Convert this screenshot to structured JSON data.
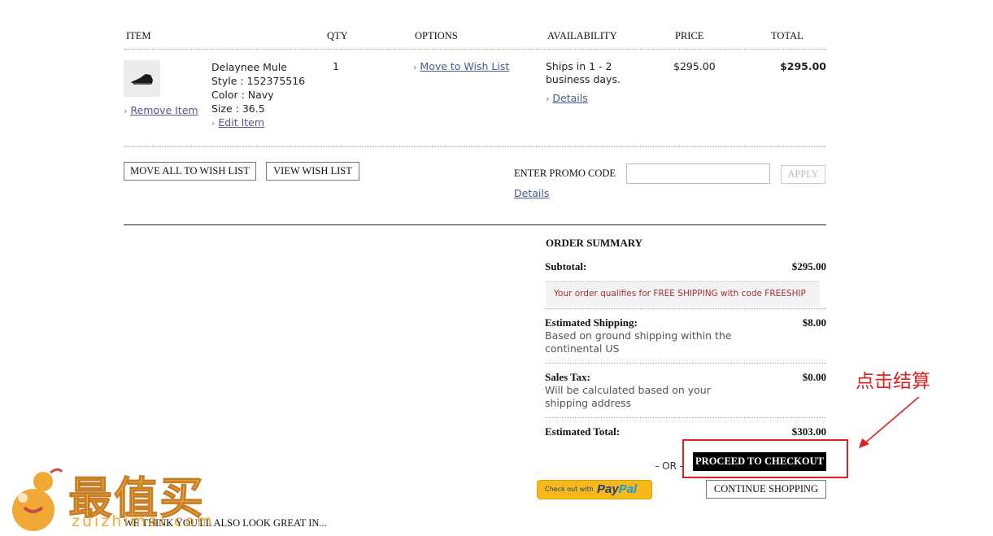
{
  "table": {
    "headers": {
      "item": "ITEM",
      "qty": "QTY",
      "options": "OPTIONS",
      "availability": "AVAILABILITY",
      "price": "PRICE",
      "total": "TOTAL"
    },
    "row": {
      "product_name": "Delaynee Mule",
      "style": "Style : 152375516",
      "color": "Color : Navy",
      "size": "Size : 36.5",
      "edit_item": "Edit Item",
      "remove_item": "Remove Item",
      "qty": "1",
      "move_to_wishlist": "Move to Wish List",
      "availability_text": "Ships in 1 - 2 business days.",
      "availability_details": "Details",
      "price": "$295.00",
      "total": "$295.00"
    }
  },
  "actions": {
    "move_all": "MOVE ALL TO WISH LIST",
    "view_wishlist": "VIEW WISH LIST"
  },
  "promo": {
    "label": "ENTER PROMO CODE",
    "value": "",
    "apply": "APPLY",
    "details": "Details"
  },
  "summary": {
    "title": "ORDER SUMMARY",
    "subtotal_label": "Subtotal:",
    "subtotal_value": "$295.00",
    "free_shipping_note": "Your order qualifies for FREE SHIPPING with code FREESHIP",
    "shipping_label": "Estimated Shipping:",
    "shipping_desc": "Based on ground shipping within the continental US",
    "shipping_value": "$8.00",
    "tax_label": "Sales Tax:",
    "tax_desc": "Will be calculated based on your shipping address",
    "tax_value": "$0.00",
    "total_label": "Estimated Total:",
    "total_value": "$303.00"
  },
  "checkout": {
    "or_text": "- OR -",
    "proceed": "PROCEED TO CHECKOUT",
    "paypal_prefix": "Check out with",
    "paypal_brand_pay": "Pay",
    "paypal_brand_pal": "Pal",
    "continue": "CONTINUE SHOPPING"
  },
  "annotation": {
    "text": "点击结算",
    "color": "#e02020"
  },
  "recommend": {
    "text": "WE THINK YOU'LL ALSO LOOK GREAT IN..."
  },
  "watermark": {
    "brand": "最值买",
    "site": "zuizhimai.com"
  },
  "colors": {
    "link": "#4a5a8a",
    "note_text": "#a33030",
    "note_bg": "#f3f3f3",
    "black_button": "#000000",
    "paypal_gold": "#f7b81c",
    "paypal_dark": "#253b80",
    "paypal_light": "#179bd7"
  }
}
